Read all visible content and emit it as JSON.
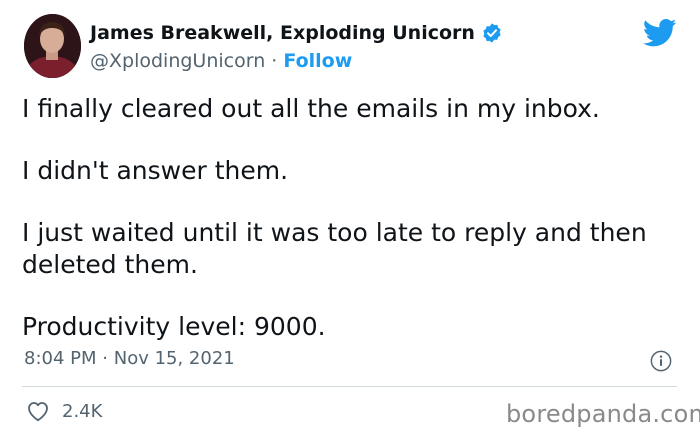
{
  "author": {
    "display_name": "James Breakwell, Exploding Unicorn",
    "handle": "@XplodingUnicorn",
    "separator": "·",
    "follow_label": "Follow",
    "verified": true
  },
  "tweet": {
    "paragraphs": [
      "I finally cleared out all the emails in my inbox.",
      "I didn't answer them.",
      "I just waited until it was too late to reply and then deleted them.",
      "Productivity level: 9000."
    ],
    "time": "8:04 PM",
    "date": "Nov 15, 2021",
    "timestamp_separator": "·",
    "likes": "2.4K"
  },
  "watermark": "boredpanda.com",
  "icons": {
    "brand": "twitter-bird-icon",
    "verified": "verified-badge-icon",
    "info": "info-icon",
    "like": "heart-icon"
  },
  "colors": {
    "text": "#0f1419",
    "secondary": "#536471",
    "accent": "#1d9bf0",
    "divider": "#cfd9de",
    "watermark": "#8a8a8a"
  }
}
